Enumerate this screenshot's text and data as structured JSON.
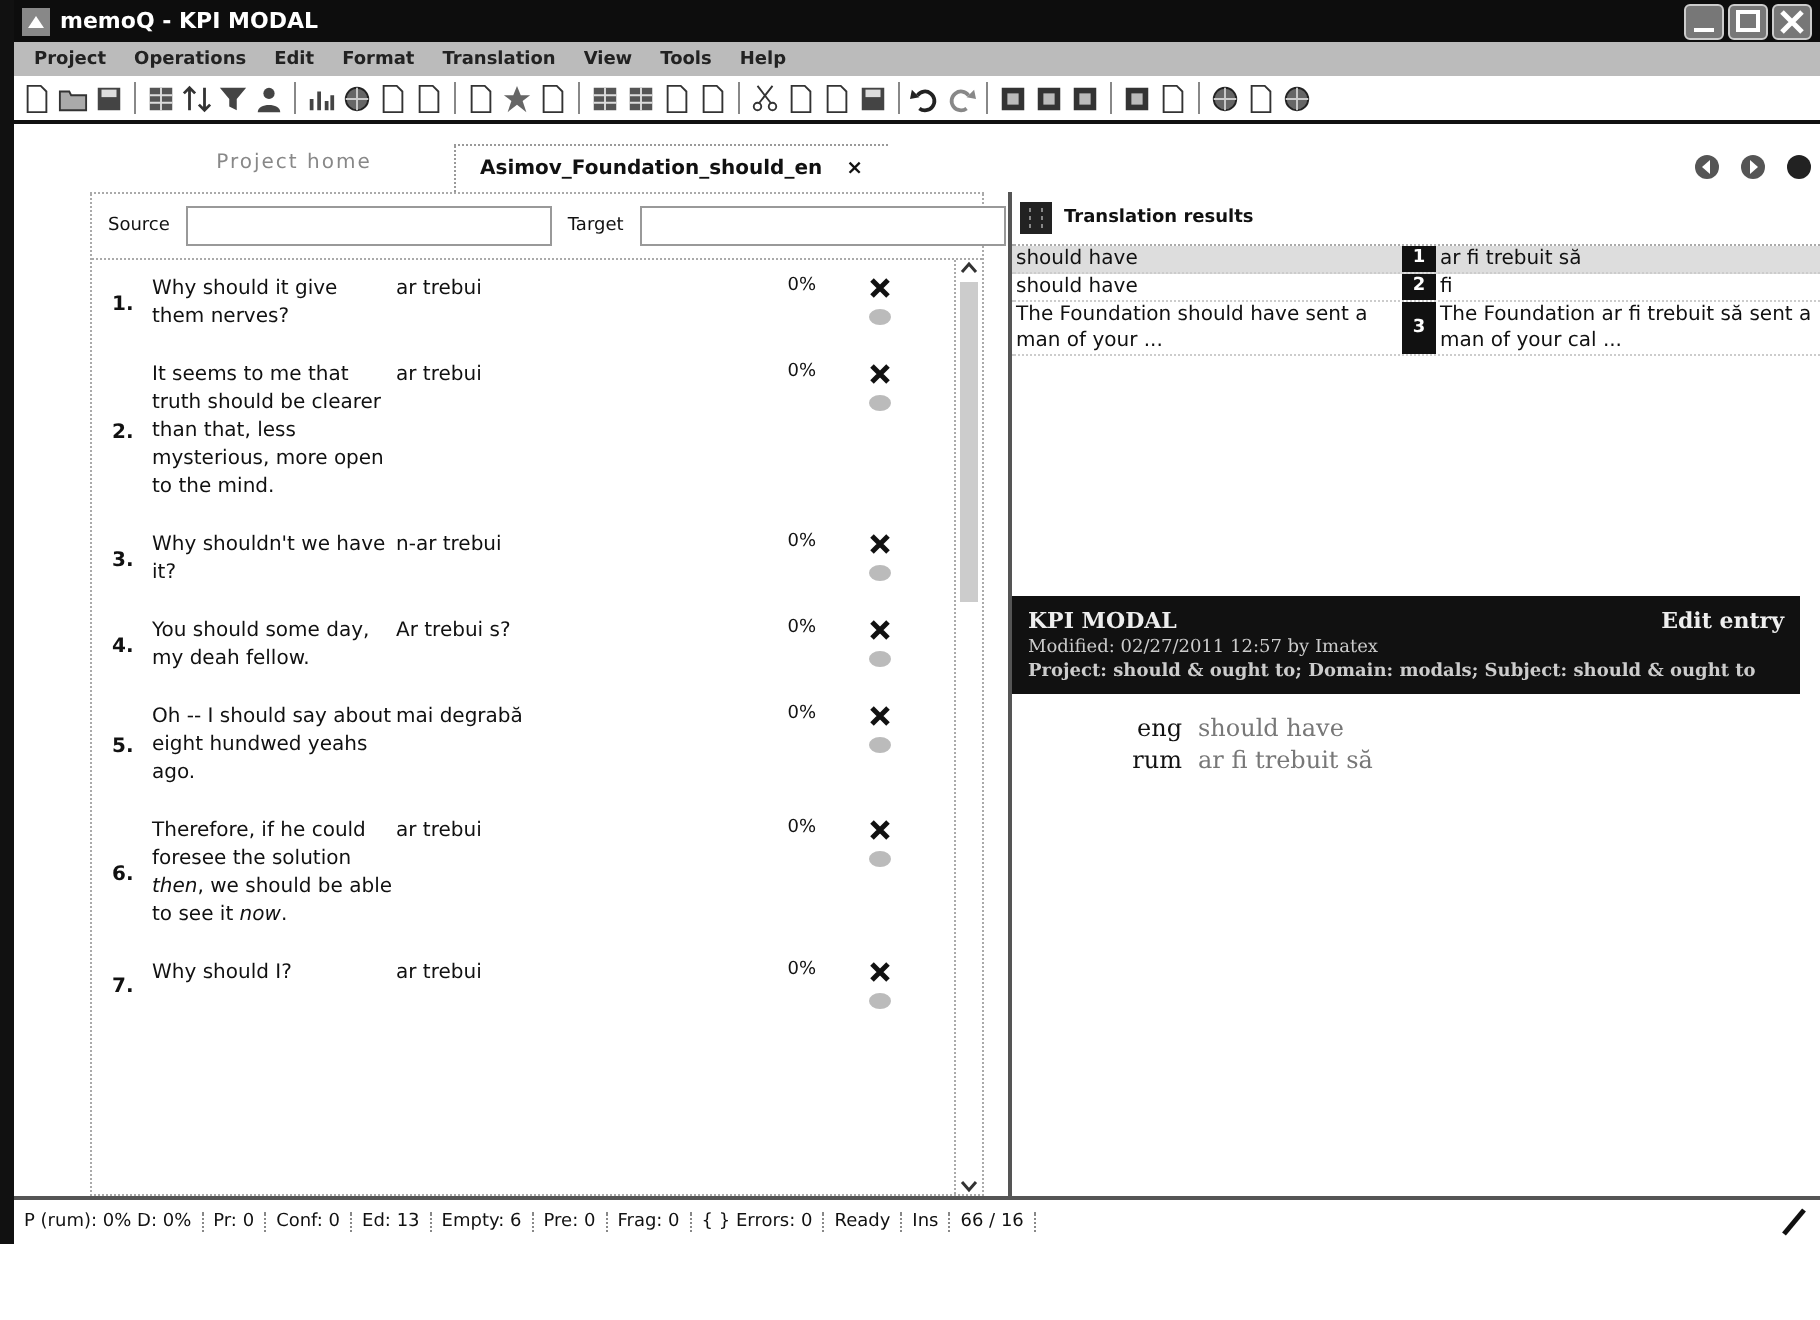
{
  "window": {
    "title": "memoQ - KPI MODAL"
  },
  "menu": [
    "Project",
    "Operations",
    "Edit",
    "Format",
    "Translation",
    "View",
    "Tools",
    "Help"
  ],
  "tabs": [
    {
      "label": "Project home",
      "selected": false
    },
    {
      "label": "Asimov_Foundation_should_en",
      "selected": true,
      "close": "×"
    }
  ],
  "filter": {
    "source_label": "Source",
    "target_label": "Target"
  },
  "segments": [
    {
      "number": "1.",
      "source": "Why should it give them nerves?",
      "target": "ar trebui",
      "match": "0%"
    },
    {
      "number": "2.",
      "source": "It seems to me that truth should be clearer than that, less mysterious, more open to the mind.",
      "target": "ar trebui",
      "match": "0%"
    },
    {
      "number": "3.",
      "source": "Why shouldn't we have it?",
      "target": "n-ar trebui",
      "match": "0%"
    },
    {
      "number": "4.",
      "source": "You should some day, my deah fellow.",
      "target": "Ar trebui s?",
      "match": "0%"
    },
    {
      "number": "5.",
      "source": "Oh -- I should say about eight hundwed yeahs ago.",
      "target": "mai degrabă",
      "match": "0%"
    },
    {
      "number": "6.",
      "source": "Therefore, if he could foresee the solution *then*, we should be able to see it *now*.",
      "target": "ar trebui",
      "match": "0%"
    },
    {
      "number": "7.",
      "source": "Why should I?",
      "target": "ar trebui",
      "match": "0%"
    }
  ],
  "results": {
    "title": "Translation results",
    "rows": [
      {
        "source": "should have",
        "index": "1",
        "target": "ar fi trebuit să",
        "selected": true
      },
      {
        "source": "should have",
        "index": "2",
        "target": "fi",
        "selected": false
      },
      {
        "source": "The Foundation should have sent a man of your ...",
        "index": "3",
        "target": "The Foundation ar fi trebuit să sent a man of your cal ...",
        "selected": false
      }
    ]
  },
  "entry": {
    "title": "KPI MODAL",
    "edit": "Edit entry",
    "modified": "Modified: 02/27/2011 12:57 by Imatex",
    "project": "Project: should & ought to; Domain: modals; Subject: should & ought to",
    "terms": [
      {
        "lang": "eng",
        "term": "should have"
      },
      {
        "lang": "rum",
        "term": "ar fi trebuit să"
      }
    ]
  },
  "status_bar": [
    "P (rum): 0% D: 0%",
    "Pr: 0",
    "Conf: 0",
    "Ed: 13",
    "Empty: 6",
    "Pre: 0",
    "Frag: 0",
    "{ } Errors: 0",
    "Ready",
    "Ins",
    "66 / 16"
  ]
}
